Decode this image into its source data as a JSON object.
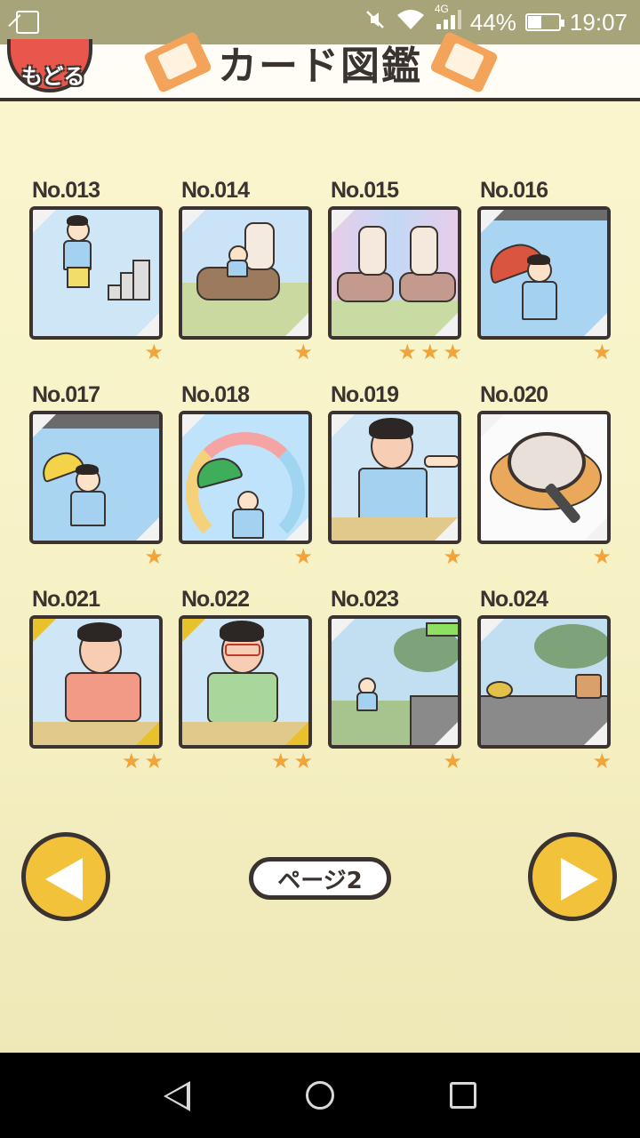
{
  "status_bar": {
    "network": "4G",
    "battery": "44%",
    "battery_level": 0.44,
    "time": "19:07"
  },
  "header": {
    "back_label": "もどる",
    "title": "カード図鑑"
  },
  "cards": [
    {
      "no": "No.013",
      "stars": 1,
      "frame": "silver",
      "scene": "jump-stairs"
    },
    {
      "no": "No.014",
      "stars": 1,
      "frame": "silver",
      "scene": "centaur-ride"
    },
    {
      "no": "No.015",
      "stars": 3,
      "frame": "silver",
      "scene": "two-centaurs"
    },
    {
      "no": "No.016",
      "stars": 1,
      "frame": "silver",
      "scene": "broken-umbrella"
    },
    {
      "no": "No.017",
      "stars": 1,
      "frame": "silver",
      "scene": "yellow-umbrella"
    },
    {
      "no": "No.018",
      "stars": 1,
      "frame": "silver",
      "scene": "rainbow"
    },
    {
      "no": "No.019",
      "stars": 1,
      "frame": "silver",
      "scene": "pointing"
    },
    {
      "no": "No.020",
      "stars": 1,
      "frame": "silver",
      "scene": "magnifier"
    },
    {
      "no": "No.021",
      "stars": 2,
      "frame": "gold",
      "scene": "angry-boy"
    },
    {
      "no": "No.022",
      "stars": 2,
      "frame": "gold",
      "scene": "glasses-boy"
    },
    {
      "no": "No.023",
      "stars": 1,
      "frame": "silver",
      "scene": "tower"
    },
    {
      "no": "No.024",
      "stars": 1,
      "frame": "silver",
      "scene": "tower-rope"
    }
  ],
  "pager": {
    "label": "ページ2",
    "prev_icon": "triangle-left-icon",
    "next_icon": "triangle-right-icon"
  },
  "colors": {
    "star": "#f0a43a",
    "outline": "#3a3330",
    "button": "#f2c23b",
    "back_button": "#e9564c"
  }
}
